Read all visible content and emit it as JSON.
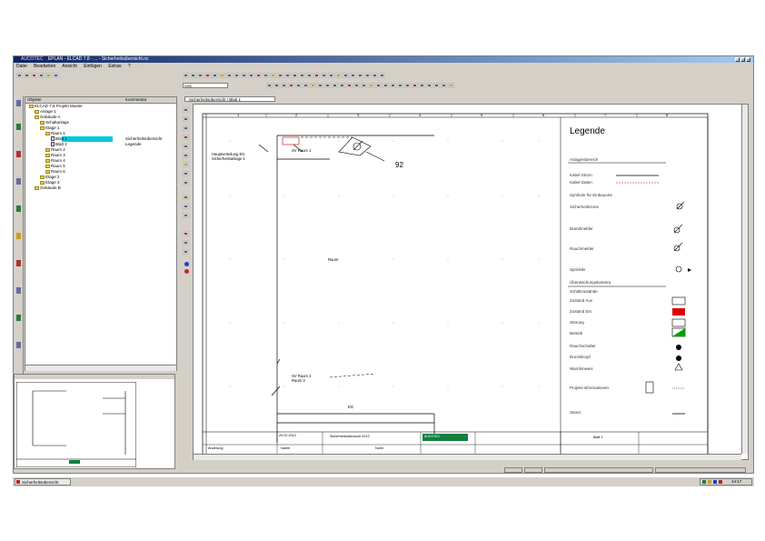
{
  "window": {
    "title": "EPLAN - ELCAD 7.8 - ... - Sicherheitsübersicht.nc",
    "logo": "AUCOTEC"
  },
  "menu": [
    "Datei",
    "Bearbeiten",
    "Ansicht",
    "Einfügen",
    "Extras",
    "?"
  ],
  "project_combo": "SHK",
  "drawing_tab": "Sicherheitsübersicht / Blatt 1",
  "tree": {
    "header_name": "Objekte",
    "header_comment": "Kommentar",
    "rows": [
      {
        "label": "ELCAD 7.8 Projekt Muster",
        "indent": 0
      },
      {
        "label": "Anlage 1",
        "indent": 1
      },
      {
        "label": "Gebäude A",
        "indent": 1
      },
      {
        "label": "Schaltanlage",
        "indent": 2
      },
      {
        "label": "Etage 1",
        "indent": 2
      },
      {
        "label": "Raum 1",
        "indent": 3
      },
      {
        "label": "Blatt 1",
        "indent": 4,
        "selected": true,
        "comment": "Sicherheitsübersicht"
      },
      {
        "label": "Blatt 2",
        "indent": 4,
        "comment": "Legende"
      },
      {
        "label": "Raum 2",
        "indent": 3
      },
      {
        "label": "Raum 3",
        "indent": 3
      },
      {
        "label": "Raum 4",
        "indent": 3
      },
      {
        "label": "Raum 5",
        "indent": 3
      },
      {
        "label": "Raum 6",
        "indent": 3
      },
      {
        "label": "Etage 2",
        "indent": 2
      },
      {
        "label": "Etage 3",
        "indent": 2
      },
      {
        "label": "Gebäude B",
        "indent": 1
      }
    ]
  },
  "drawing": {
    "legend_title": "Legende",
    "legend_items": [
      "Anlagenbereich",
      "Kabel Strom",
      "Kabel Daten",
      "Symbole für Einbauorte",
      "Sicherheitszone",
      "Brandmelder",
      "Rauchmelder",
      "Sprinkler",
      "Überwachungskamera",
      "Schaltzustände",
      "Zustand Aus",
      "Zustand Ein",
      "Störung",
      "Betrieb",
      "Rauchschalter",
      "Druckknopf",
      "Warnhinweis",
      "Projekt-Informationen",
      "Stand"
    ],
    "callout_number": "92",
    "label_left": "Hauptverteilung EG\nSicherheitsanlage 1",
    "label_top": "SV Raum 1",
    "label_mid": "Raum",
    "label_bottom": "SV Raum 2\nRaum 3",
    "label_floor": "EG",
    "column_numbers": [
      "1",
      "2",
      "3",
      "4",
      "5",
      "6",
      "7",
      "8"
    ],
    "title_block": {
      "date": "29.02.2012",
      "project": "Sicherheitsübersicht 2012",
      "sheet": "Blatt 1",
      "company": "AUCOTEC",
      "revision": "Änderung",
      "name": "Name",
      "norm": "Norm"
    }
  },
  "taskbar": {
    "item": "Sicherheitsübersicht",
    "clock": "14:17"
  },
  "colors": {
    "title_active": "#0a246a",
    "selection": "#00c8d8",
    "red": "#e00000",
    "green": "#00a000",
    "folder": "#e8d048"
  }
}
